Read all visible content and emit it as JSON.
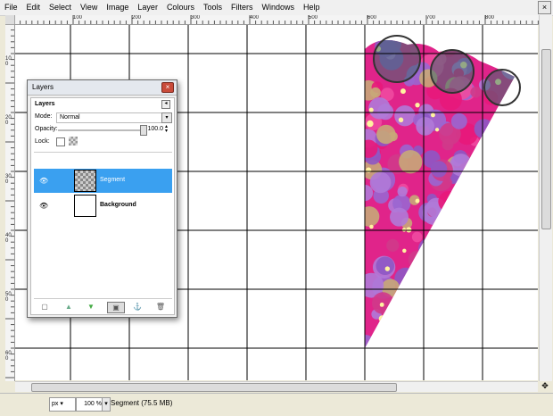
{
  "menubar": {
    "items": [
      {
        "label": "File"
      },
      {
        "label": "Edit"
      },
      {
        "label": "Select"
      },
      {
        "label": "View"
      },
      {
        "label": "Image"
      },
      {
        "label": "Layer"
      },
      {
        "label": "Colours"
      },
      {
        "label": "Tools"
      },
      {
        "label": "Filters"
      },
      {
        "label": "Windows"
      },
      {
        "label": "Help"
      }
    ],
    "close_glyph": "×"
  },
  "rulers": {
    "horizontal": [
      "100",
      "200",
      "300",
      "400",
      "500",
      "600",
      "700",
      "800"
    ],
    "vertical": [
      "100",
      "200",
      "300",
      "400",
      "500",
      "600"
    ]
  },
  "layers_dialog": {
    "title": "Layers",
    "tab_label": "Layers",
    "mode_label": "Mode:",
    "mode_value": "Normal",
    "opacity_label": "Opacity:",
    "opacity_value": "100.0",
    "lock_label": "Lock:",
    "layers": [
      {
        "name": "Segment",
        "selected": true,
        "visible": true
      },
      {
        "name": "Background",
        "selected": false,
        "visible": true
      }
    ]
  },
  "status": {
    "unit": "px",
    "zoom": "100 %",
    "info": "Segment (75.5 MB)"
  },
  "colors": {
    "selection": "#3aa0f0",
    "grid": "#000000"
  }
}
